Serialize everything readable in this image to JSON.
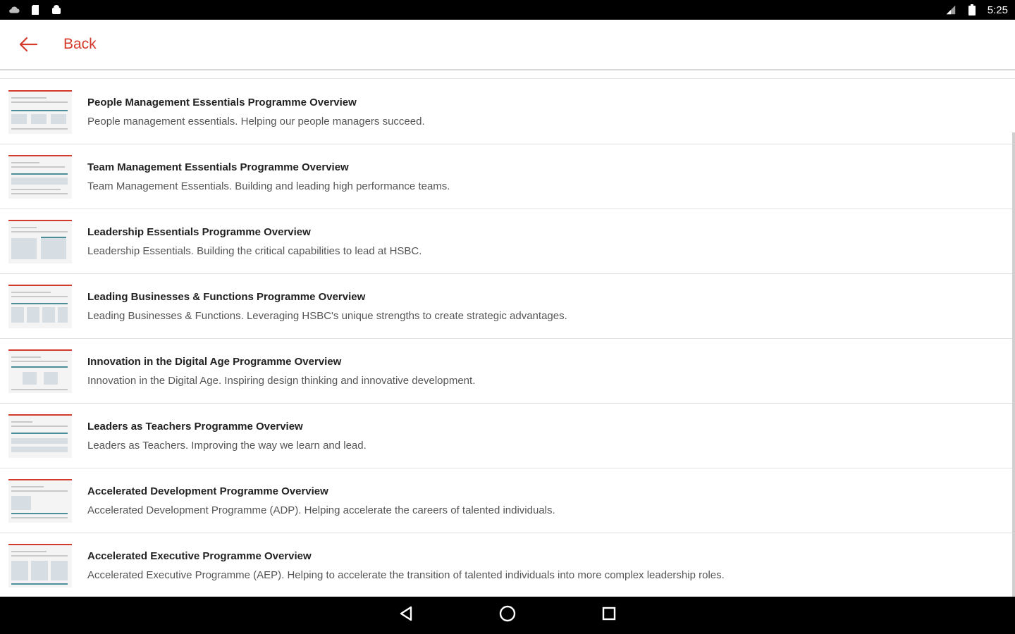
{
  "status_bar": {
    "time": "5:25",
    "left_icons": [
      "cloud-icon",
      "sd-card-icon",
      "android-icon"
    ],
    "right_icons": [
      "signal-icon",
      "battery-icon"
    ]
  },
  "app_bar": {
    "back_label": "Back",
    "accent_color": "#d33a2c"
  },
  "items": [
    {
      "title": "People Management Essentials Programme Overview",
      "description": "People management essentials. Helping our people managers succeed."
    },
    {
      "title": "Team Management Essentials Programme Overview",
      "description": "Team Management Essentials. Building and leading high performance teams."
    },
    {
      "title": "Leadership Essentials Programme Overview",
      "description": "Leadership Essentials. Building the critical capabilities to lead at HSBC."
    },
    {
      "title": "Leading Businesses & Functions Programme Overview",
      "description": "Leading Businesses & Functions. Leveraging HSBC's unique strengths to create strategic advantages."
    },
    {
      "title": "Innovation in the Digital Age Programme Overview",
      "description": "Innovation in the Digital Age. Inspiring design thinking and innovative development."
    },
    {
      "title": "Leaders as Teachers Programme Overview",
      "description": "Leaders as Teachers. Improving the way we learn and lead."
    },
    {
      "title": "Accelerated Development Programme Overview",
      "description": "Accelerated Development Programme (ADP). Helping accelerate the careers of talented individuals."
    },
    {
      "title": "Accelerated Executive Programme Overview",
      "description": "Accelerated Executive Programme (AEP). Helping to accelerate the transition of talented individuals into more complex leadership roles."
    }
  ],
  "nav_bar": {
    "buttons": [
      "back-triangle-icon",
      "home-circle-icon",
      "recents-square-icon"
    ]
  }
}
